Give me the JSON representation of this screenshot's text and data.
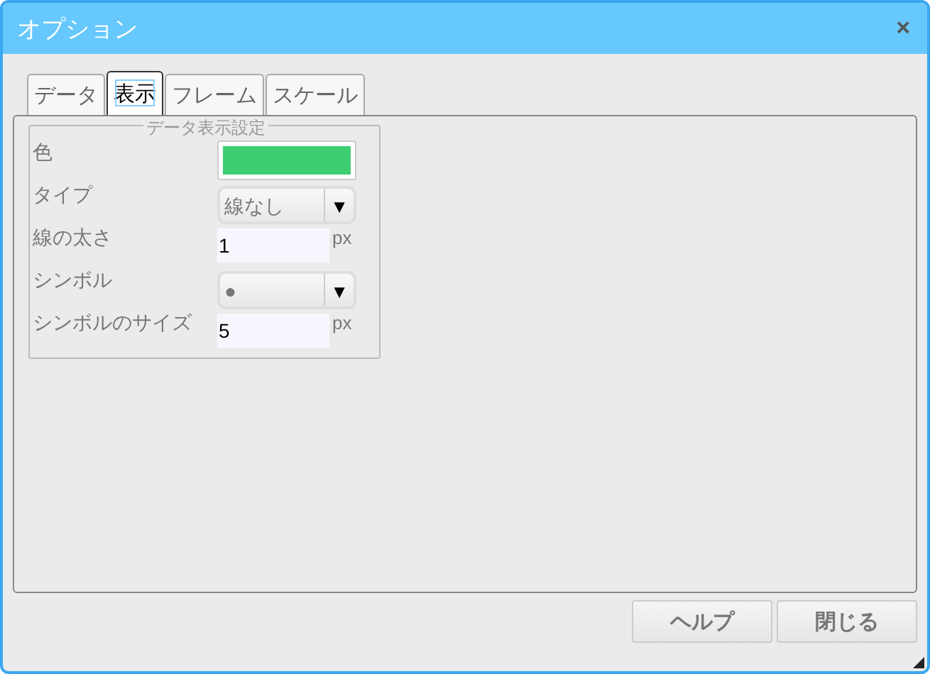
{
  "window": {
    "title": "オプション",
    "close": "×"
  },
  "tabs": [
    {
      "label": "データ",
      "selected": false
    },
    {
      "label": "表示",
      "selected": true
    },
    {
      "label": "フレーム",
      "selected": false
    },
    {
      "label": "スケール",
      "selected": false
    }
  ],
  "group": {
    "legend": "データ表示設定",
    "rows": [
      {
        "kind": "color",
        "label": "色",
        "color": "#3cce70"
      },
      {
        "kind": "select",
        "label": "タイプ",
        "value": "線なし",
        "arrow": "▼"
      },
      {
        "kind": "number",
        "label": "線の太さ",
        "value": "1",
        "unit": "px"
      },
      {
        "kind": "select",
        "label": "シンボル",
        "value": "●",
        "arrow": "▼"
      },
      {
        "kind": "number",
        "label": "シンボルのサイズ",
        "value": "5",
        "unit": "px"
      }
    ]
  },
  "buttons": [
    "ヘルプ",
    "閉じる"
  ]
}
